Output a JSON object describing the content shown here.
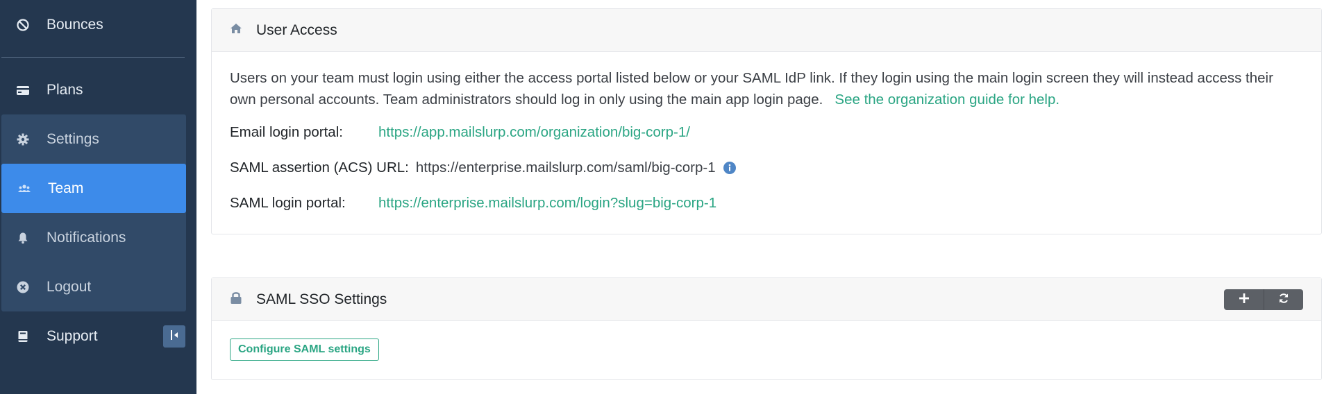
{
  "sidebar": {
    "items": [
      {
        "label": "Bounces",
        "icon": "ban-icon"
      },
      {
        "label": "Plans",
        "icon": "credit-card-icon"
      },
      {
        "label": "Settings",
        "icon": "gear-icon"
      },
      {
        "label": "Team",
        "icon": "users-icon",
        "active": true
      },
      {
        "label": "Notifications",
        "icon": "bell-icon"
      },
      {
        "label": "Logout",
        "icon": "close-circle-icon"
      },
      {
        "label": "Support",
        "icon": "book-icon"
      }
    ]
  },
  "user_access": {
    "title": "User Access",
    "intro": "Users on your team must login using either the access portal listed below or your SAML IdP link. If they login using the main login screen they will instead access their own personal accounts. Team administrators should log in only using the main app login page.",
    "guide_link": "See the organization guide for help.",
    "email_portal_label": "Email login portal:",
    "email_portal_url": "https://app.mailslurp.com/organization/big-corp-1/",
    "acs_label": "SAML assertion (ACS) URL:",
    "acs_url": "https://enterprise.mailslurp.com/saml/big-corp-1",
    "saml_portal_label": "SAML login portal:",
    "saml_portal_url": "https://enterprise.mailslurp.com/login?slug=big-corp-1"
  },
  "saml_sso": {
    "title": "SAML SSO Settings",
    "configure_button": "Configure SAML settings"
  },
  "colors": {
    "sidebar_bg": "#24374f",
    "active_bg": "#3d8bea",
    "link": "#2aa583"
  }
}
